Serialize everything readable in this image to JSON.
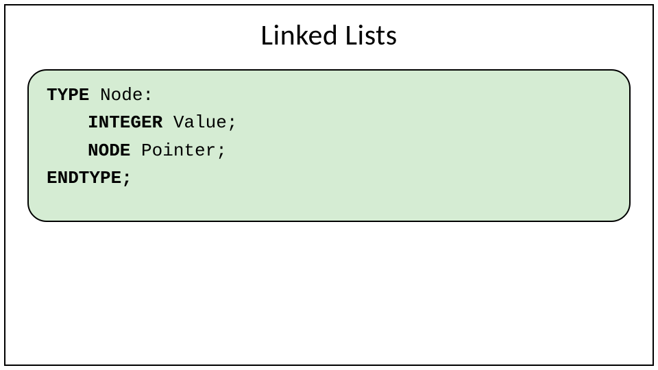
{
  "title": "Linked Lists",
  "code": {
    "l1a": "TYPE",
    "l1b": " Node:",
    "l2a": "INTEGER",
    "l2b": " Value;",
    "l3a": "NODE",
    "l3b": " Pointer;",
    "l4": "ENDTYPE;"
  }
}
